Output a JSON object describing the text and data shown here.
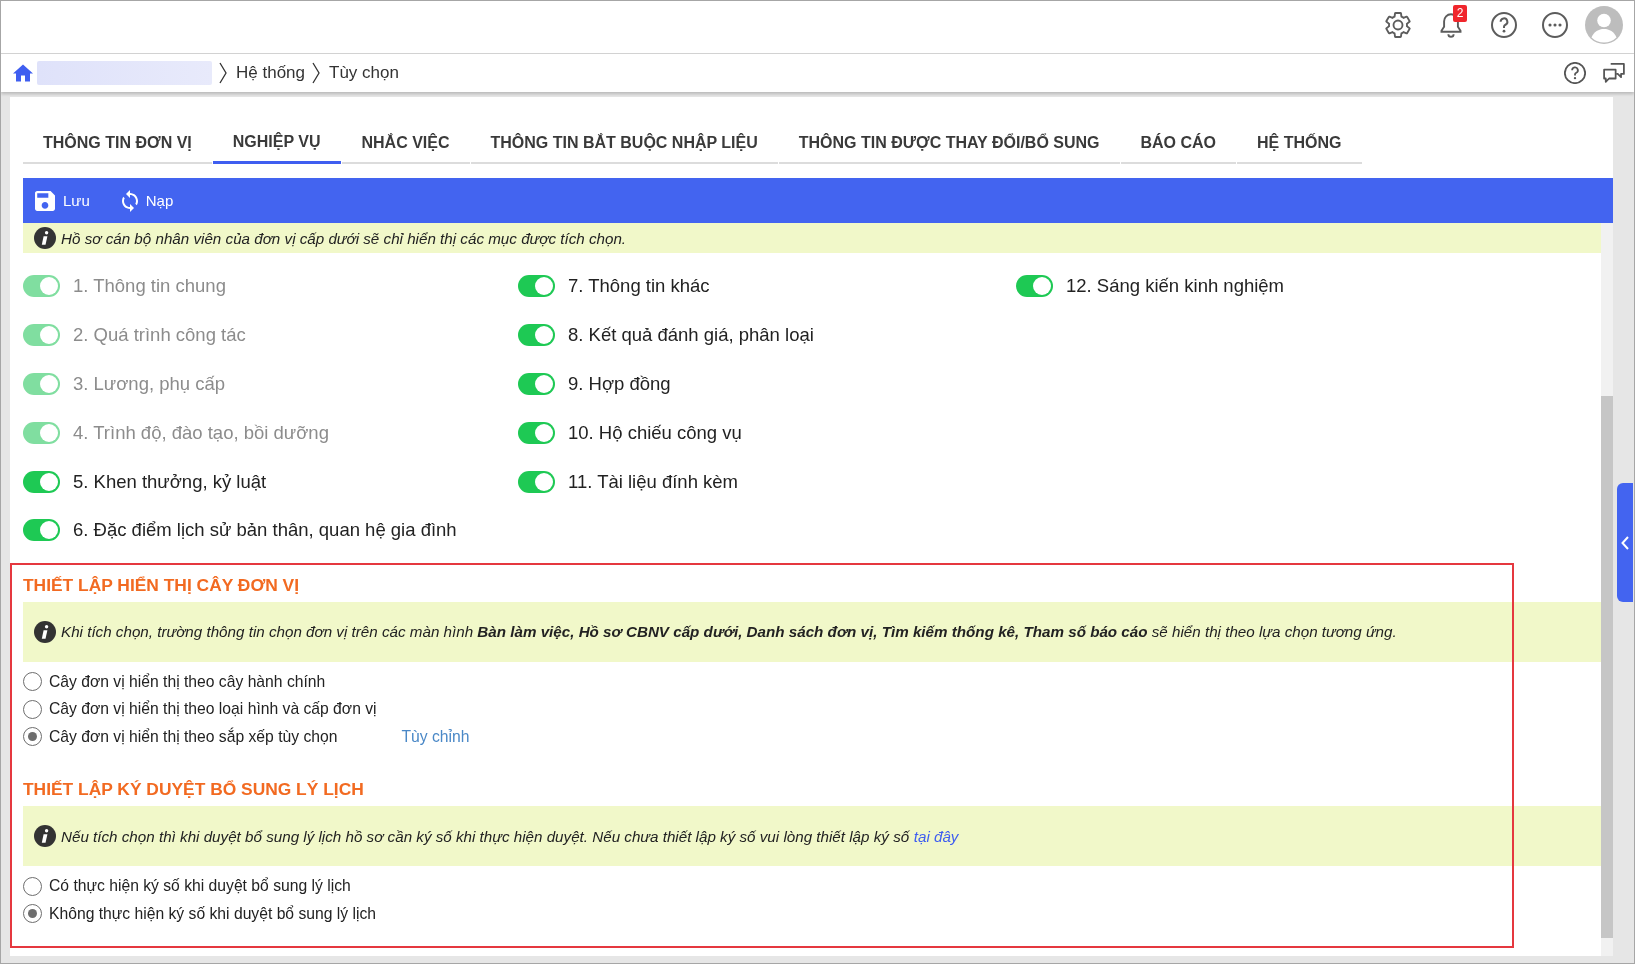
{
  "header": {
    "notification_count": "2"
  },
  "breadcrumb": {
    "items": [
      {
        "kind": "blurred"
      },
      {
        "kind": "text",
        "label": "Hệ thống"
      },
      {
        "kind": "text",
        "label": "Tùy chọn"
      }
    ]
  },
  "tabs": [
    {
      "label": "THÔNG TIN ĐƠN VỊ",
      "selected": false
    },
    {
      "label": "NGHIỆP VỤ",
      "selected": true
    },
    {
      "label": "NHẮC VIỆC",
      "selected": false
    },
    {
      "label": "THÔNG TIN BẮT BUỘC NHẬP LIỆU",
      "selected": false
    },
    {
      "label": "THÔNG TIN ĐƯỢC THAY ĐỔI/BỔ SUNG",
      "selected": false
    },
    {
      "label": "BÁO CÁO",
      "selected": false
    },
    {
      "label": "HỆ THỐNG",
      "selected": false
    }
  ],
  "toolbar": {
    "buttons": [
      {
        "kind": "save",
        "label": "Lưu"
      },
      {
        "kind": "reload",
        "label": "Nạp"
      }
    ]
  },
  "notice": {
    "text": "Hồ sơ cán bộ nhân viên của đơn vị cấp dưới sẽ chỉ hiển thị các mục được tích chọn."
  },
  "display_options": {
    "columns": [
      {
        "items": [
          {
            "label": "1. Thông tin chung",
            "on": true,
            "disabled": true
          },
          {
            "label": "2. Quá trình công tác",
            "on": true,
            "disabled": true
          },
          {
            "label": "3. Lương, phụ cấp",
            "on": true,
            "disabled": true
          },
          {
            "label": "4. Trình độ, đào tạo, bồi dưỡng",
            "on": true,
            "disabled": true
          },
          {
            "label": "5. Khen thưởng, kỷ luật",
            "on": true,
            "disabled": false
          },
          {
            "label": "6. Đặc điểm lịch sử bản thân, quan hệ gia đình",
            "on": true,
            "disabled": false
          }
        ]
      },
      {
        "items": [
          {
            "label": "7. Thông tin khác",
            "on": true,
            "disabled": false
          },
          {
            "label": "8. Kết quả đánh giá, phân loại",
            "on": true,
            "disabled": false
          },
          {
            "label": "9. Hợp đồng",
            "on": true,
            "disabled": false
          },
          {
            "label": "10. Hộ chiếu công vụ",
            "on": true,
            "disabled": false
          },
          {
            "label": "11. Tài liệu đính kèm",
            "on": true,
            "disabled": false
          }
        ]
      },
      {
        "items": [
          {
            "label": "12. Sáng kiến kinh nghiệm",
            "on": true,
            "disabled": false
          }
        ]
      }
    ]
  },
  "sections": [
    {
      "title": "THIẾT LẬP HIỂN THỊ CÂY ĐƠN VỊ",
      "note": "Khi tích chọn, trường thông tin chọn đơn vị trên các màn hình **Bàn làm việc, Hồ sơ CBNV cấp dưới, Danh sách đơn vị, Tìm kiếm thống kê, Tham số báo cáo** sẽ hiển thị theo lựa chọn tương ứng.",
      "options": [
        {
          "label": "Cây đơn vị hiển thị theo cây hành chính",
          "selected": false
        },
        {
          "label": "Cây đơn vị hiển thị theo loại hình và cấp đơn vị",
          "selected": false
        },
        {
          "label": "Cây đơn vị hiển thị theo sắp xếp tùy chọn",
          "selected": true,
          "link": "Tùy chỉnh"
        }
      ]
    },
    {
      "title": "THIẾT LẬP KÝ DUYỆT BỔ SUNG LÝ LỊCH",
      "note": "Nếu tích chọn thì khi duyệt bổ sung lý lịch hồ sơ cần ký số khi thực hiện duyệt. Nếu chưa thiết lập ký số vui lòng thiết lập ký số",
      "note_link": "tại đây",
      "options": [
        {
          "label": "Có thực hiện ký số khi duyệt bổ sung lý lịch",
          "selected": false
        },
        {
          "label": "Không thực hiện ký số khi duyệt bổ sung lý lịch",
          "selected": true
        }
      ]
    }
  ]
}
